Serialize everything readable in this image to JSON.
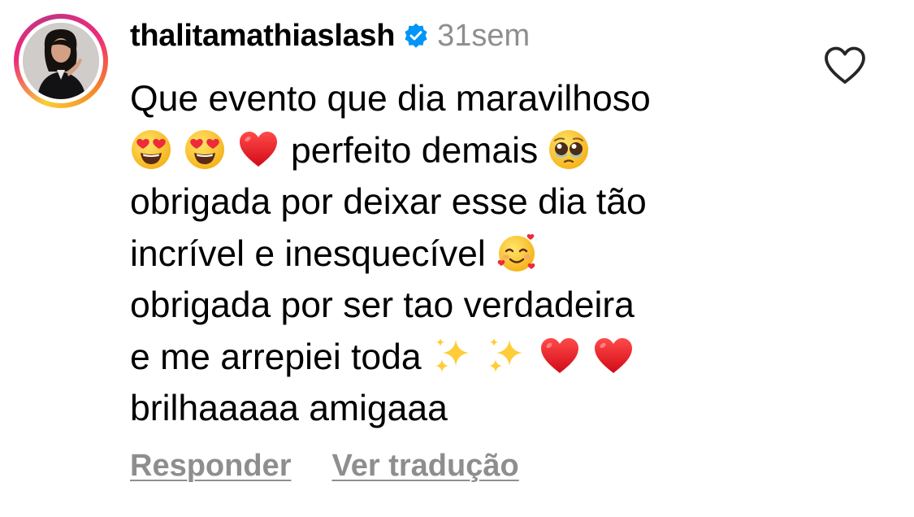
{
  "comment": {
    "username": "thalitamathiaslash",
    "verified": true,
    "time": "31sem",
    "lines": [
      [
        {
          "t": "text",
          "v": "Que evento que dia maravilhoso"
        }
      ],
      [
        {
          "t": "emoji",
          "v": "heart-eyes"
        },
        {
          "t": "emoji",
          "v": "heart-eyes"
        },
        {
          "t": "emoji",
          "v": "red-heart"
        },
        {
          "t": "text",
          "v": "perfeito demais"
        },
        {
          "t": "emoji",
          "v": "pleading-face"
        }
      ],
      [
        {
          "t": "text",
          "v": "obrigada por deixar esse dia tão"
        }
      ],
      [
        {
          "t": "text",
          "v": "incrível e inesquecível"
        },
        {
          "t": "emoji",
          "v": "smiling-face-with-hearts"
        }
      ],
      [
        {
          "t": "text",
          "v": "obrigada por ser tao verdadeira"
        }
      ],
      [
        {
          "t": "text",
          "v": "e me arrepiei toda"
        },
        {
          "t": "emoji",
          "v": "sparkles"
        },
        {
          "t": "emoji",
          "v": "sparkles"
        },
        {
          "t": "emoji",
          "v": "red-heart"
        },
        {
          "t": "emoji",
          "v": "red-heart"
        }
      ],
      [
        {
          "t": "text",
          "v": "brilhaaaaa amigaaa"
        }
      ]
    ],
    "actions": {
      "reply": "Responder",
      "translate": "Ver tradução"
    }
  },
  "icons": {
    "verified": "verified-badge-icon",
    "like": "heart-outline-icon"
  },
  "colors": {
    "verified_blue": "#0095f6",
    "muted_text": "#8e8e8e",
    "heart_outline": "#262626"
  }
}
